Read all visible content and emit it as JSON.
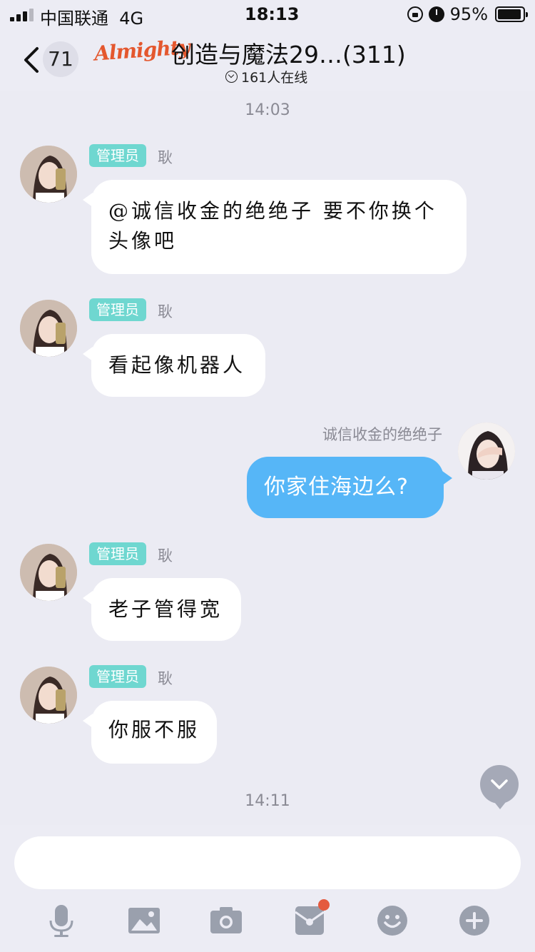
{
  "status_bar": {
    "carrier": "中国联通",
    "network": "4G",
    "time": "18:13",
    "battery": "95%",
    "battery_level": 0.95
  },
  "header": {
    "back_count": "71",
    "brand": "Almighty",
    "title": "创造与魔法29…(311)",
    "online": "161人在线"
  },
  "messages": [
    {
      "type": "time",
      "text": "14:03"
    },
    {
      "type": "incoming",
      "tag": "管理员",
      "name": "耿",
      "text_lines": [
        "@诚信收金的绝绝子 要不你换个",
        "头像吧"
      ]
    },
    {
      "type": "incoming",
      "tag": "管理员",
      "name": "耿",
      "text_lines": [
        "看起像机器人"
      ]
    },
    {
      "type": "outgoing",
      "name": "诚信收金的绝绝子",
      "text_lines": [
        "你家住海边么?"
      ]
    },
    {
      "type": "incoming",
      "tag": "管理员",
      "name": "耿",
      "text_lines": [
        "老子管得宽"
      ]
    },
    {
      "type": "incoming",
      "tag": "管理员",
      "name": "耿",
      "text_lines": [
        "你服不服"
      ]
    },
    {
      "type": "time",
      "text": "14:11"
    }
  ],
  "input": {
    "value": "",
    "placeholder": ""
  },
  "toolbar": {
    "icons": [
      "microphone-icon",
      "image-icon",
      "camera-icon",
      "red-packet-icon",
      "emoji-icon",
      "plus-icon"
    ]
  },
  "colors": {
    "admin_tag": "#6fd7d0",
    "outgoing_bubble": "#56b6f7",
    "brand": "#e4572e",
    "toolbar_icon": "#9aa0ad",
    "badge_dot": "#e45a3f"
  }
}
